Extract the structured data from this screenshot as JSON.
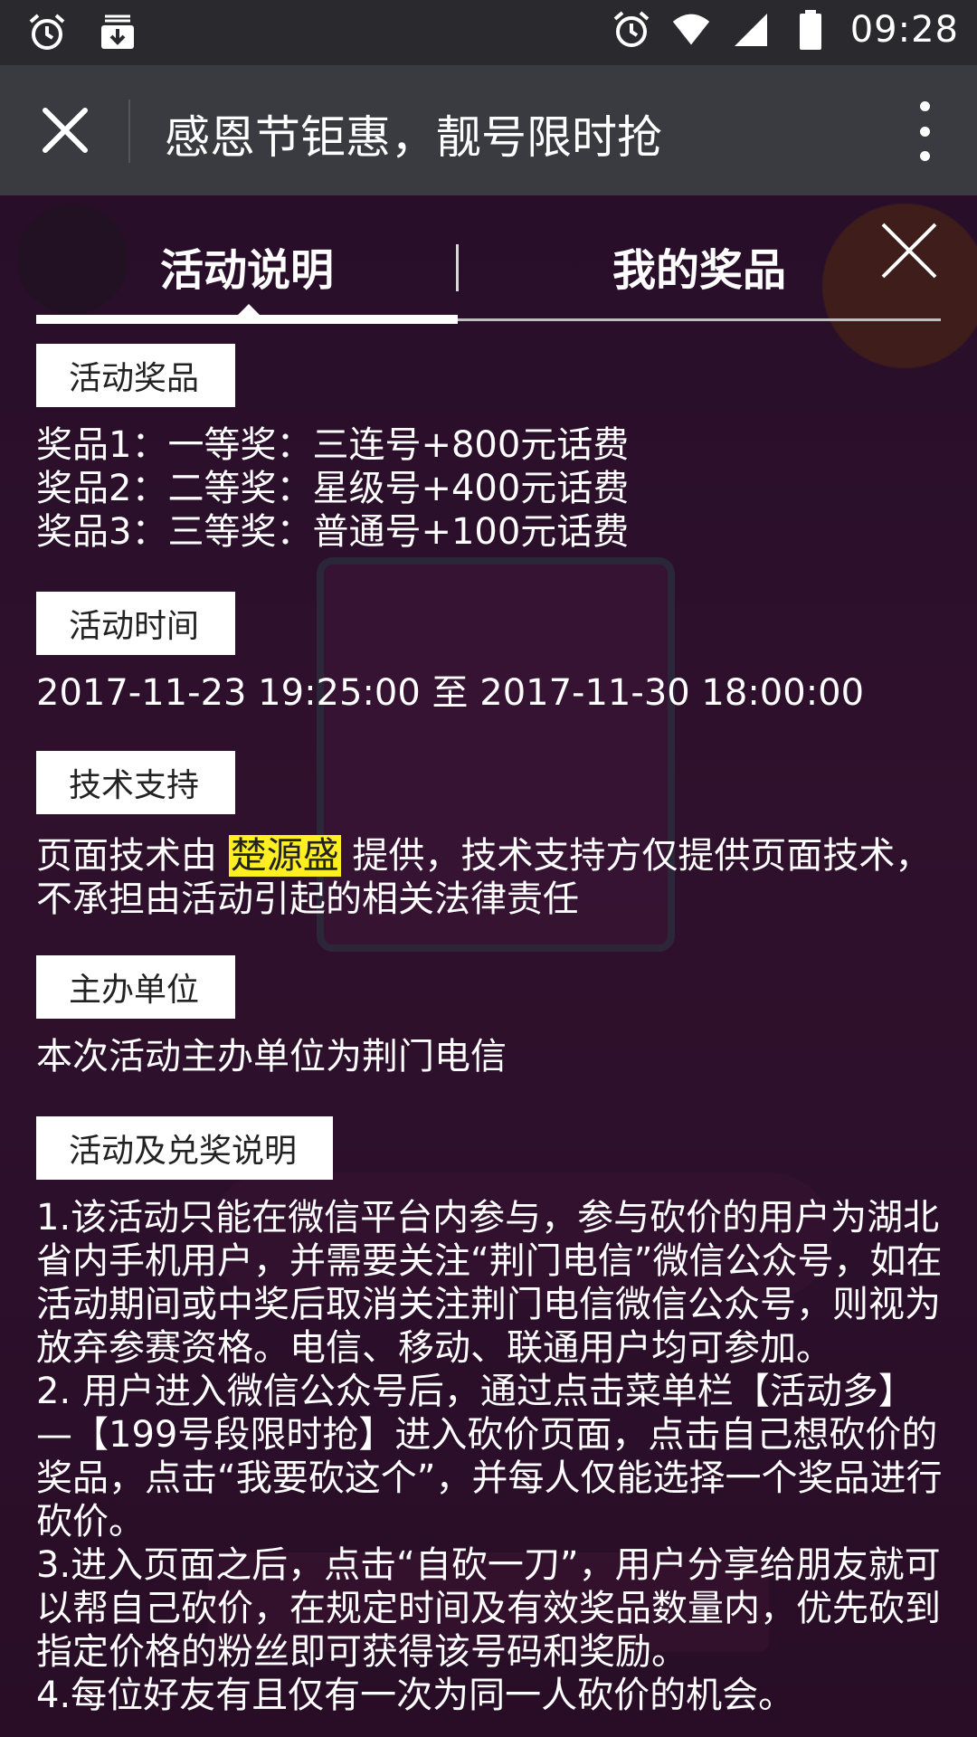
{
  "status_bar": {
    "time": "09:28"
  },
  "title_bar": {
    "title": "感恩节钜惠，靓号限时抢"
  },
  "tabs": {
    "active": "活动说明",
    "other": "我的奖品"
  },
  "sections": {
    "prizes": {
      "label": "活动奖品",
      "lines": [
        "奖品1：一等奖：三连号+800元话费",
        "奖品2：二等奖：星级号+400元话费",
        "奖品3：三等奖：普通号+100元话费"
      ]
    },
    "time": {
      "label": "活动时间",
      "text": "2017-11-23 19:25:00 至 2017-11-30 18:00:00"
    },
    "tech": {
      "label": "技术支持",
      "text_before": "页面技术由 ",
      "highlight": "楚源盛",
      "text_after": " 提供，技术支持方仅提供页面技术，不承担由活动引起的相关法律责任"
    },
    "organizer": {
      "label": "主办单位",
      "text": "本次活动主办单位为荆门电信"
    },
    "rules": {
      "label": "活动及兑奖说明",
      "text": "1.该活动只能在微信平台内参与，参与砍价的用户为湖北省内手机用户，并需要关注“荆门电信”微信公众号，如在活动期间或中奖后取消关注荆门电信微信公众号，则视为放弃参赛资格。电信、移动、联通用户均可参加。\n2. 用户进入微信公众号后，通过点击菜单栏【活动多】—【199号段限时抢】进入砍价页面，点击自己想砍价的奖品，点击“我要砍这个”，并每人仅能选择一个奖品进行砍价。\n3.进入页面之后，点击“自砍一刀”，用户分享给朋友就可以帮自己砍价，在规定时间及有效奖品数量内，优先砍到指定价格的粉丝即可获得该号码和奖励。\n4.每位好友有且仅有一次为同一人砍价的机会。"
    }
  },
  "colors": {
    "highlight": "#ffee22",
    "overlay": "#1b0d24"
  }
}
